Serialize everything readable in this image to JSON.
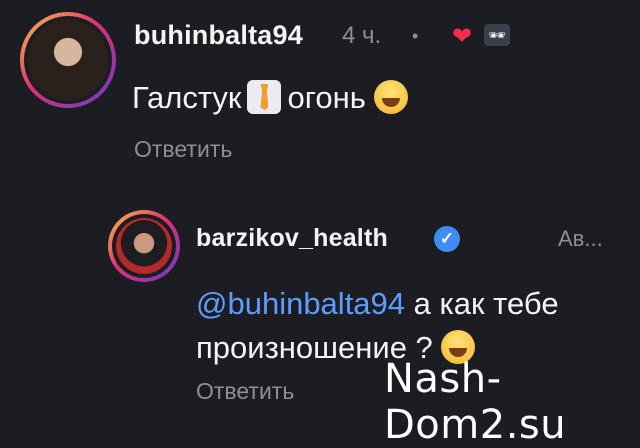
{
  "comment": {
    "username": "buhinbalta94",
    "time": "4 ч.",
    "dot": "•",
    "liked_icon": "heart-icon",
    "author_avatar_icon": "creator-avatar-mini",
    "text_before": "Галстук",
    "text_after": "огонь",
    "emoji1": "necktie-emoji",
    "emoji2": "laughing-emoji",
    "reply_label": "Ответить"
  },
  "reply": {
    "username": "barzikov_health",
    "verified_icon": "verified-icon",
    "badge": "Ав...",
    "mention": "@buhinbalta94",
    "text_line1": "а как тебе",
    "text_line2": "произношение ?",
    "emoji": "laughing-emoji",
    "reply_label": "Ответить"
  },
  "watermark": "Nash-Dom2.su",
  "colors": {
    "background": "#1b1d22",
    "mention": "#5e9dff",
    "muted": "#8e8f96",
    "heart": "#ff2d4b",
    "verified": "#3d8df5"
  }
}
